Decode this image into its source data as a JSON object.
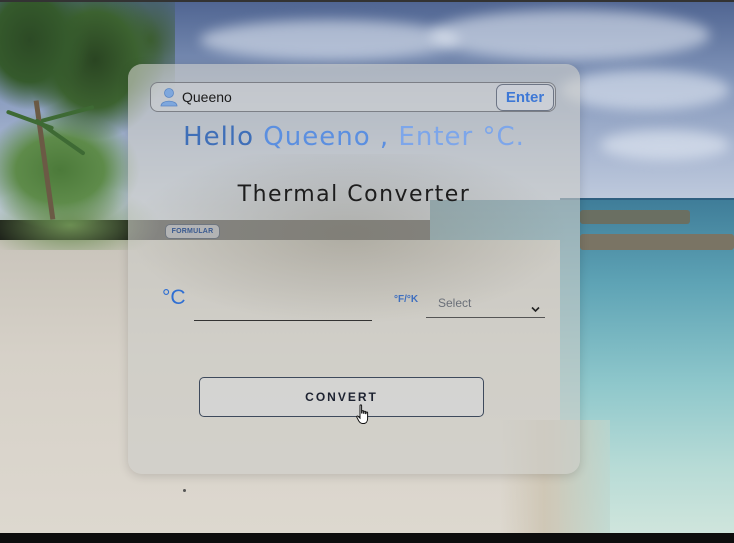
{
  "name_bar": {
    "icon": "user-icon",
    "name_value": "Queeno",
    "enter_label": "Enter"
  },
  "greeting": {
    "hello": "Hello",
    "name": "Queeno ,",
    "prompt": "Enter °C."
  },
  "title": "Thermal Converter",
  "formular_label": "FORMULAR",
  "celsius_label": "°C",
  "celsius_value": "",
  "unit_label": "°F/°K",
  "unit_select": {
    "selected": "Select",
    "icon": "chevron-down-icon"
  },
  "convert_label": "CONVERT",
  "cursor_icon": "hand-pointer-icon",
  "colors": {
    "accent": "#3e78d6",
    "text": "#1d1d1d"
  }
}
